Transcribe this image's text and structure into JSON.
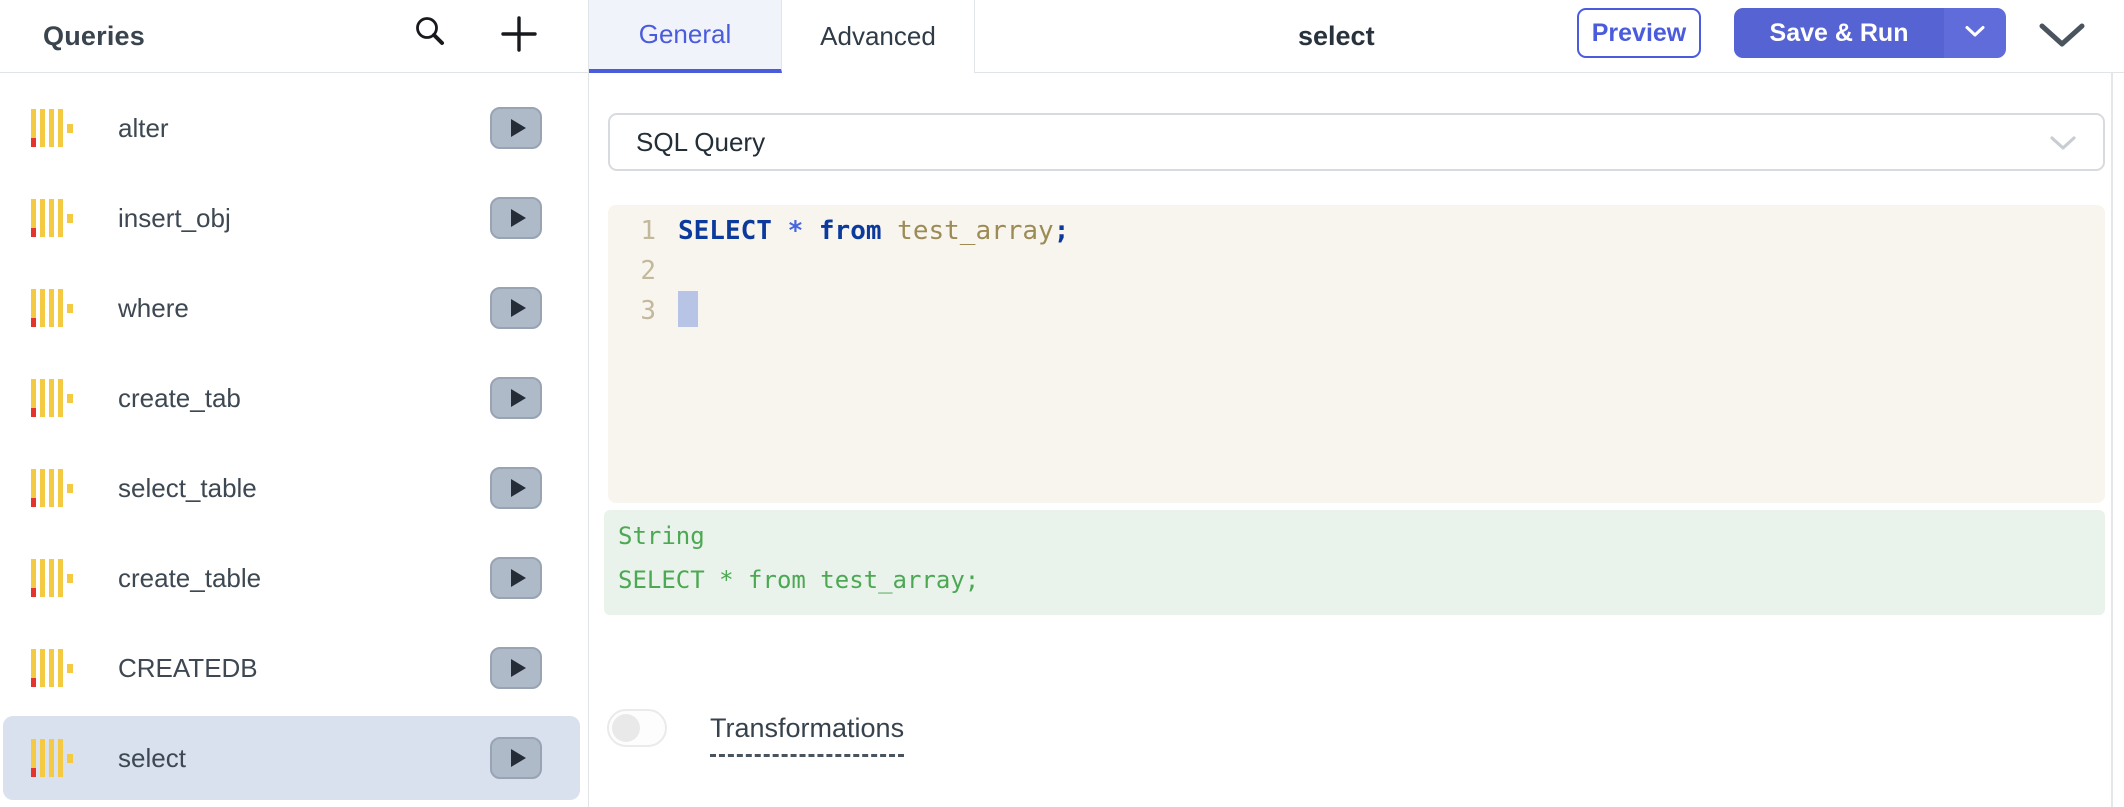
{
  "sidebar": {
    "title": "Queries",
    "items": [
      {
        "label": "alter",
        "selected": false
      },
      {
        "label": "insert_obj",
        "selected": false
      },
      {
        "label": "where",
        "selected": false
      },
      {
        "label": "create_tab",
        "selected": false
      },
      {
        "label": "select_table",
        "selected": false
      },
      {
        "label": "create_table",
        "selected": false
      },
      {
        "label": "CREATEDB",
        "selected": false
      },
      {
        "label": "select",
        "selected": true
      }
    ]
  },
  "header": {
    "tabs": [
      {
        "label": "General",
        "active": true
      },
      {
        "label": "Advanced",
        "active": false
      }
    ],
    "query_title": "select",
    "preview_button": "Preview",
    "save_run_button": "Save & Run"
  },
  "query_form": {
    "command_select_value": "SQL Query",
    "code_editor": {
      "lines": [
        {
          "number": "1",
          "cursor": false,
          "tokens": [
            {
              "text": "SELECT ",
              "type": "kw"
            },
            {
              "text": "* ",
              "type": "op"
            },
            {
              "text": "from ",
              "type": "kw"
            },
            {
              "text": "test_array",
              "type": "var"
            },
            {
              "text": ";",
              "type": "punct"
            }
          ]
        },
        {
          "number": "2",
          "cursor": false,
          "tokens": []
        },
        {
          "number": "3",
          "cursor": true,
          "tokens": []
        }
      ]
    },
    "evaluated_value": {
      "type_label": "String",
      "value": "SELECT * from test_array;"
    },
    "transformations": {
      "label": "Transformations",
      "enabled": false
    }
  },
  "colors": {
    "accent_blue": "#4A5BDC",
    "save_run_bg": "#5663D3",
    "selected_row_bg": "#D8E1ED",
    "editor_bg": "#F8F5EE",
    "eval_bg": "#E9F3EB",
    "eval_text": "#4CA853",
    "datasource_icon_yellow": "#F4CA43",
    "datasource_icon_red": "#E5332D"
  }
}
